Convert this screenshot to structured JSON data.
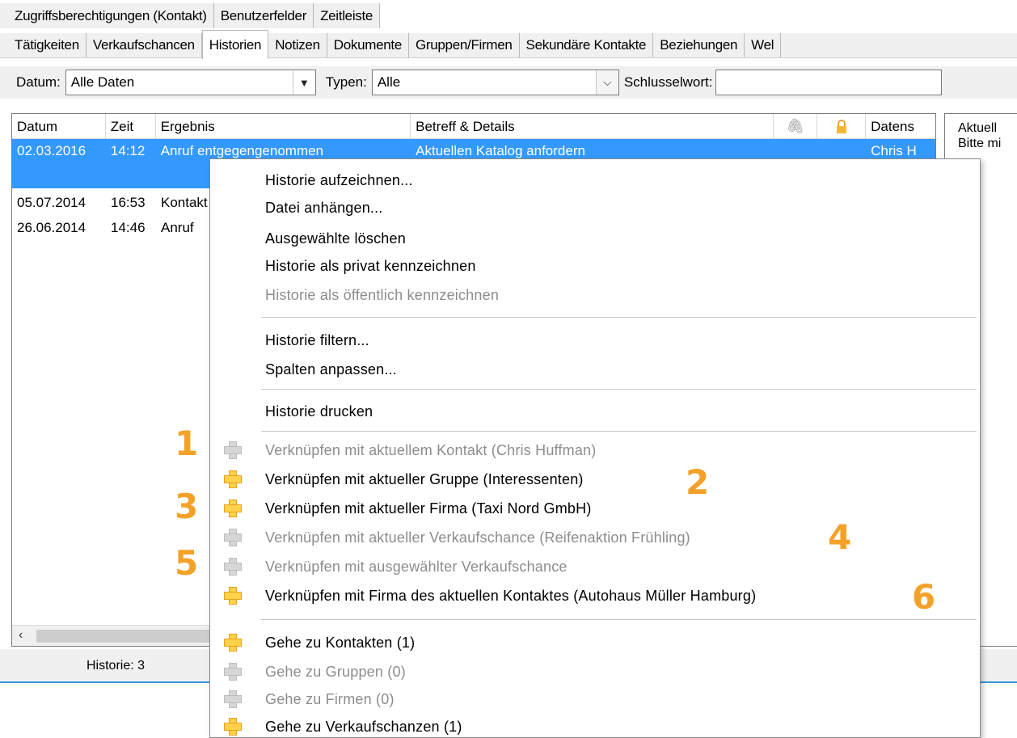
{
  "tabs_row1": [
    "Zugriffsberechtigungen (Kontakt)",
    "Benutzerfelder",
    "Zeitleiste"
  ],
  "tabs_row2": [
    "Tätigkeiten",
    "Verkaufschancen",
    "Historien",
    "Notizen",
    "Dokumente",
    "Gruppen/Firmen",
    "Sekundäre Kontakte",
    "Beziehungen",
    "Wel"
  ],
  "active_tab": "Historien",
  "filter": {
    "datum_label": "Datum:",
    "datum_value": "Alle Daten",
    "typen_label": "Typen:",
    "typen_value": "Alle",
    "schluessel_label": "Schlusselwort:",
    "schluessel_value": ""
  },
  "grid": {
    "headers": [
      "Datum",
      "Zeit",
      "Ergebnis",
      "Betreff & Details",
      "",
      "",
      "Datens"
    ],
    "rows": [
      {
        "datum": "02.03.2016",
        "zeit": "14:12",
        "ergebnis": "Anruf entgegengenommen",
        "betreff": "Aktuellen Katalog anfordern",
        "datens": "Chris H"
      },
      {
        "datum": "05.07.2014",
        "zeit": "16:53",
        "ergebnis": "Kontakt",
        "betreff": "",
        "datens": ""
      },
      {
        "datum": "26.06.2014",
        "zeit": "14:46",
        "ergebnis": "Anruf",
        "betreff": "",
        "datens": ""
      }
    ]
  },
  "right_panel": {
    "line1": "Aktuell",
    "line2": "Bitte mi"
  },
  "status": {
    "historie_count": "Historie: 3"
  },
  "context_menu": {
    "items": [
      {
        "label": "Historie aufzeichnen...",
        "enabled": true
      },
      {
        "label": "Datei anhängen...",
        "enabled": true
      },
      {
        "label": "Ausgewählte löschen",
        "enabled": true
      },
      {
        "label": "Historie als privat kennzeichnen",
        "enabled": true
      },
      {
        "label": "Historie als öffentlich kennzeichnen",
        "enabled": false
      },
      {
        "label": "Historie filtern...",
        "enabled": true
      },
      {
        "label": "Spalten anpassen...",
        "enabled": true
      },
      {
        "label": "Historie drucken",
        "enabled": true
      },
      {
        "label": "Verknüpfen mit aktuellem Kontakt (Chris Huffman)",
        "enabled": false
      },
      {
        "label": "Verknüpfen mit aktueller Gruppe (Interessenten)",
        "enabled": true
      },
      {
        "label": "Verknüpfen mit aktueller Firma (Taxi Nord GmbH)",
        "enabled": true
      },
      {
        "label": "Verknüpfen mit aktueller Verkaufschance (Reifenaktion Frühling)",
        "enabled": false
      },
      {
        "label": "Verknüpfen mit ausgewählter Verkaufschance",
        "enabled": false
      },
      {
        "label": "Verknüpfen mit Firma des aktuellen Kontaktes (Autohaus Müller Hamburg)",
        "enabled": true
      },
      {
        "label": "Gehe zu Kontakten (1)",
        "enabled": true
      },
      {
        "label": "Gehe zu Gruppen (0)",
        "enabled": false
      },
      {
        "label": "Gehe zu Firmen (0)",
        "enabled": false
      },
      {
        "label": "Gehe zu Verkaufschanzen (1)",
        "enabled": true
      }
    ]
  },
  "annotations": [
    "1",
    "2",
    "3",
    "4",
    "5",
    "6"
  ],
  "colors": {
    "selection": "#3399ff",
    "accent_orange": "#f4a12a",
    "plus_active": "#ffd24a",
    "plus_disabled": "#d6d6d6"
  }
}
